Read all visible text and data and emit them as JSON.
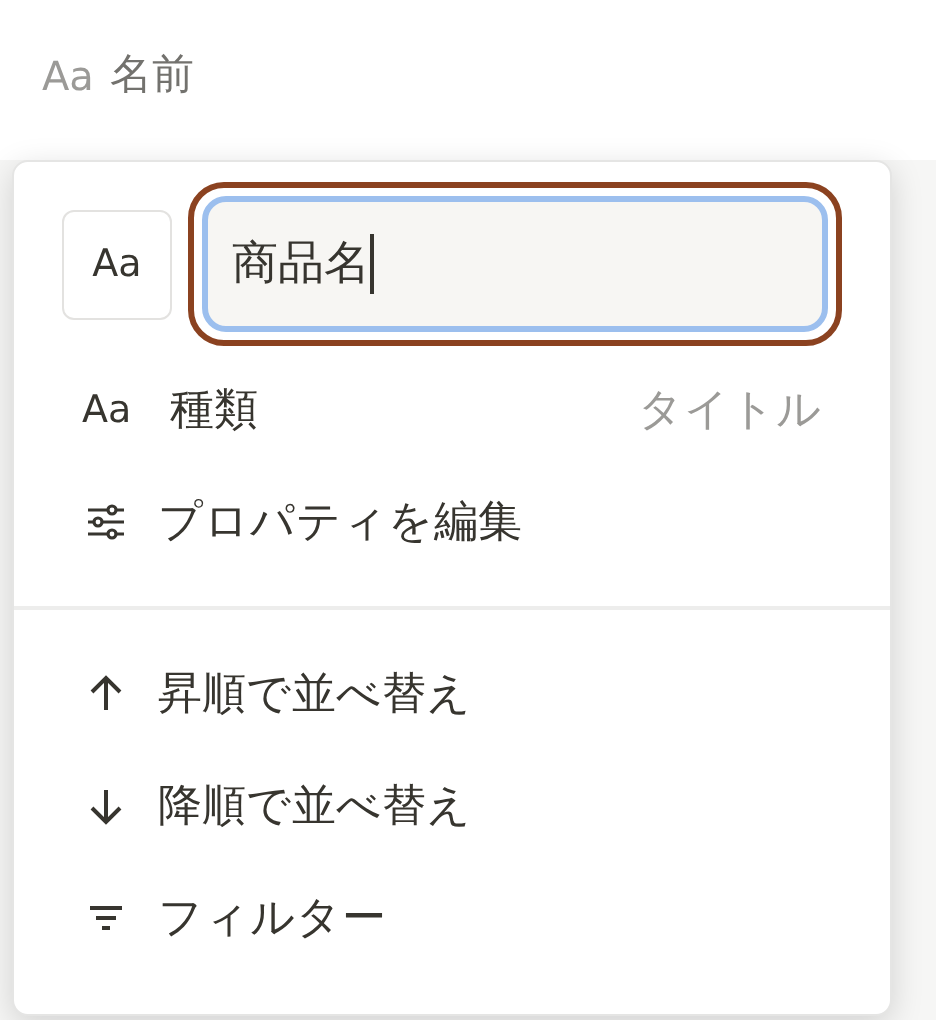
{
  "header": {
    "icon_text": "Aa",
    "label": "名前"
  },
  "menu": {
    "type_button": "Aa",
    "name_field": {
      "value": "商品名",
      "focused": true
    },
    "sections": [
      [
        {
          "kind": "text-icon",
          "icon_text": "Aa",
          "label": "種類",
          "value": "タイトル"
        },
        {
          "kind": "sliders",
          "label": "プロパティを編集"
        }
      ],
      [
        {
          "kind": "arrow-up",
          "label": "昇順で並べ替え"
        },
        {
          "kind": "arrow-down",
          "label": "降順で並べ替え"
        },
        {
          "kind": "filter",
          "label": "フィルター"
        }
      ]
    ]
  }
}
